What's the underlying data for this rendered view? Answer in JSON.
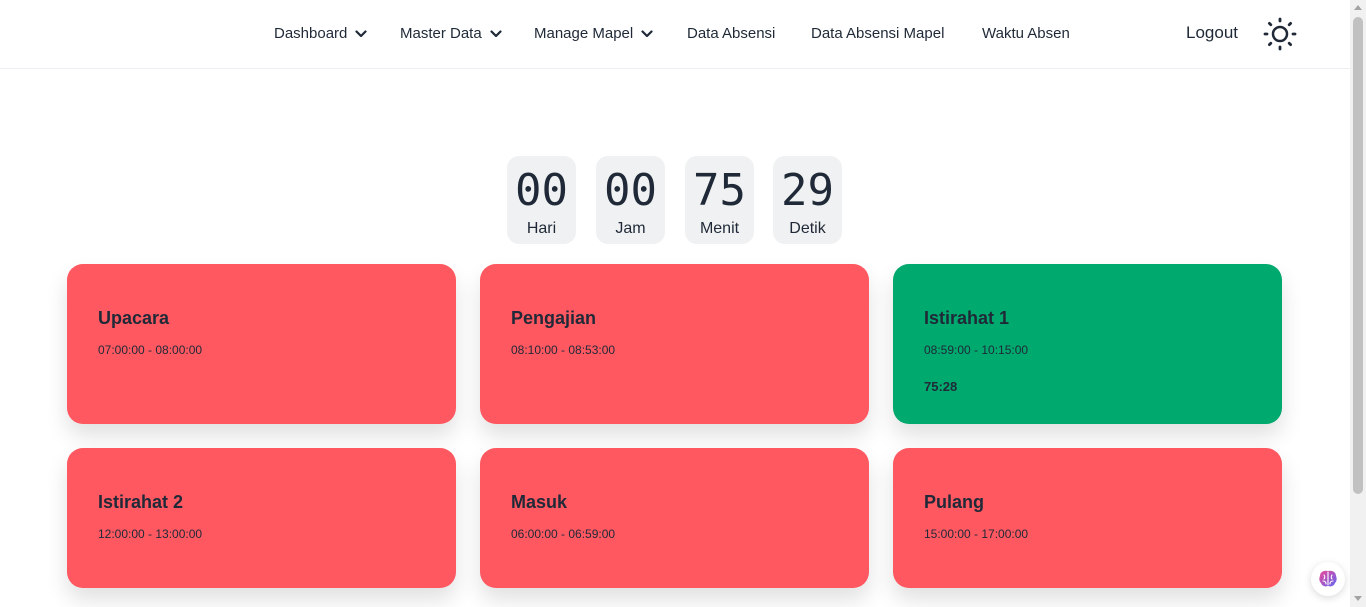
{
  "nav": {
    "items": [
      {
        "label": "Dashboard",
        "dropdown": true
      },
      {
        "label": "Master Data",
        "dropdown": true
      },
      {
        "label": "Manage Mapel",
        "dropdown": true
      },
      {
        "label": "Data Absensi",
        "dropdown": false
      },
      {
        "label": "Data Absensi Mapel",
        "dropdown": false
      },
      {
        "label": "Waktu Absen",
        "dropdown": false
      }
    ],
    "logout_label": "Logout",
    "theme_icon": "sun-icon"
  },
  "countdown": [
    {
      "value": "00",
      "label": "Hari"
    },
    {
      "value": "00",
      "label": "Jam"
    },
    {
      "value": "75",
      "label": "Menit"
    },
    {
      "value": "29",
      "label": "Detik"
    }
  ],
  "schedule": [
    {
      "title": "Upacara",
      "time": "07:00:00 - 08:00:00",
      "status": "inactive",
      "remaining": ""
    },
    {
      "title": "Pengajian",
      "time": "08:10:00 - 08:53:00",
      "status": "inactive",
      "remaining": ""
    },
    {
      "title": "Istirahat 1",
      "time": "08:59:00 - 10:15:00",
      "status": "active",
      "remaining": "75:28"
    },
    {
      "title": "Istirahat 2",
      "time": "12:00:00 - 13:00:00",
      "status": "inactive",
      "remaining": ""
    },
    {
      "title": "Masuk",
      "time": "06:00:00 - 06:59:00",
      "status": "inactive",
      "remaining": ""
    },
    {
      "title": "Pulang",
      "time": "15:00:00 - 17:00:00",
      "status": "inactive",
      "remaining": ""
    }
  ],
  "colors": {
    "inactive": "#ff5861",
    "active": "#00a96e",
    "text": "#1f2937"
  },
  "floating_button_icon": "brain-icon"
}
